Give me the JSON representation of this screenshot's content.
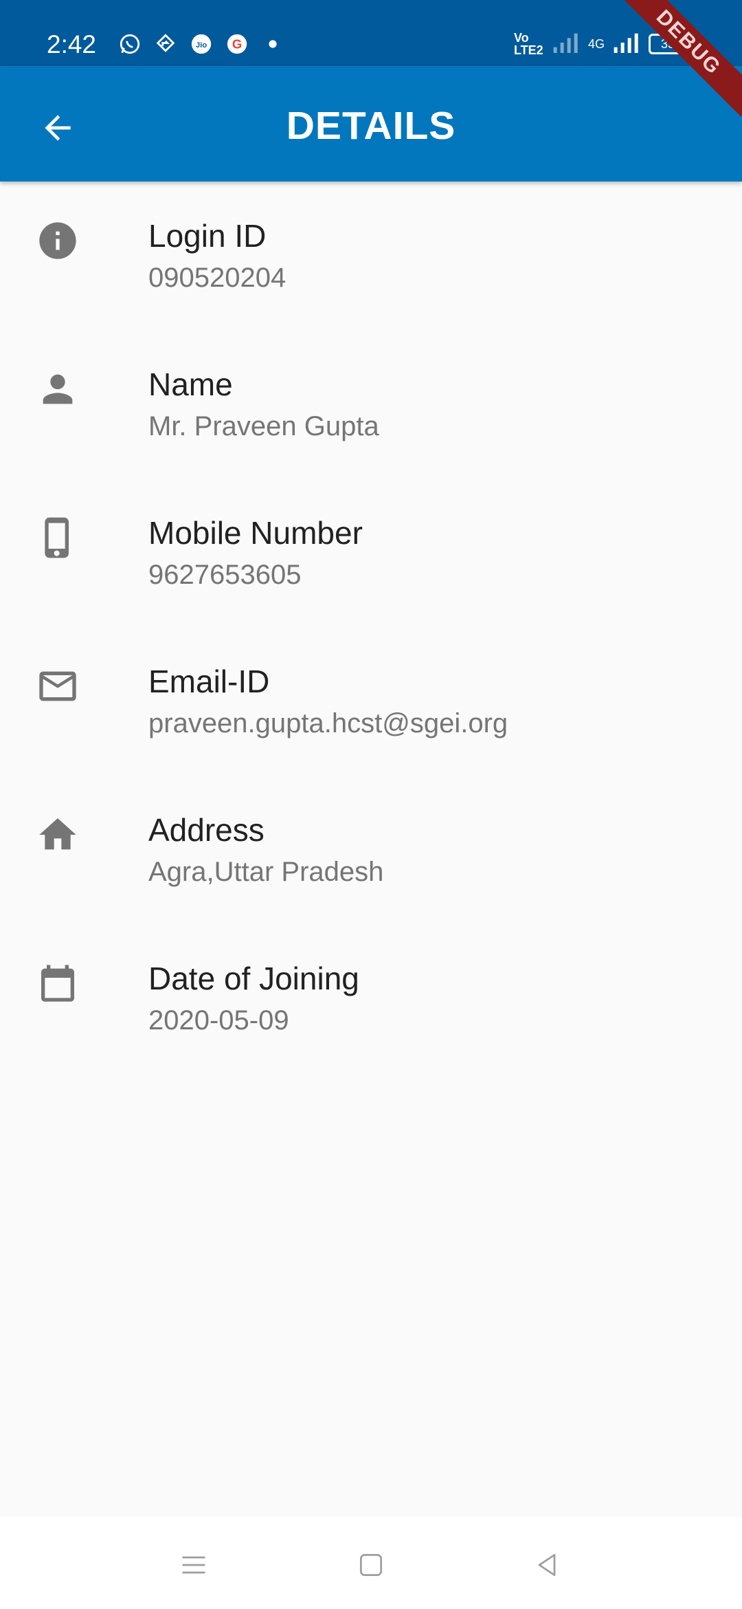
{
  "status_bar": {
    "time": "2:42",
    "left_icons": [
      "whatsapp-icon",
      "navigation-icon",
      "jio-icon",
      "google-icon",
      "dot-icon"
    ],
    "network_label": "4G",
    "volte_label": "Vo LTE2",
    "battery_level": "33"
  },
  "app_bar": {
    "title": "DETAILS",
    "back_icon": "arrow-back-icon",
    "color": "#0277bd"
  },
  "debug_banner": "DEBUG",
  "details": [
    {
      "icon": "info-icon",
      "title": "Login ID",
      "value": "090520204"
    },
    {
      "icon": "person-icon",
      "title": "Name",
      "value": "Mr. Praveen Gupta"
    },
    {
      "icon": "phone-icon",
      "title": "Mobile Number",
      "value": "9627653605"
    },
    {
      "icon": "mail-icon",
      "title": "Email-ID",
      "value": "praveen.gupta.hcst@sgei.org"
    },
    {
      "icon": "home-icon",
      "title": "Address",
      "value": "Agra,Uttar Pradesh"
    },
    {
      "icon": "calendar-icon",
      "title": "Date of Joining",
      "value": "2020-05-09"
    }
  ],
  "nav_bar": {
    "buttons": [
      "menu-icon",
      "home-square-icon",
      "back-triangle-icon"
    ]
  }
}
